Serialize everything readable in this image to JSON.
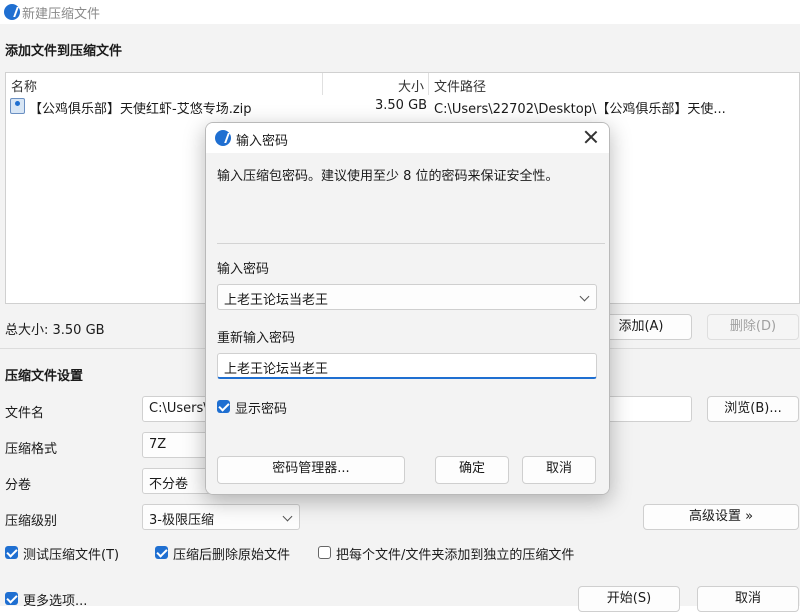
{
  "window": {
    "title": "新建压缩文件"
  },
  "add_section": {
    "title": "添加文件到压缩文件"
  },
  "file_list": {
    "columns": [
      "名称",
      "大小",
      "文件路径"
    ],
    "rows": [
      {
        "name": "【公鸡俱乐部】天使红虾-艾悠专场.zip",
        "size": "3.50 GB",
        "path": "C:\\Users\\22702\\Desktop\\【公鸡俱乐部】天使..."
      }
    ]
  },
  "total": {
    "label": "总大小: 3.50 GB"
  },
  "buttons": {
    "add": "添加(A)",
    "delete": "删除(D)",
    "browse": "浏览(B)...",
    "advanced": "高级设置 »",
    "start": "开始(S)",
    "cancel": "取消"
  },
  "settings": {
    "title": "压缩文件设置",
    "filename_label": "文件名",
    "filename_value": "C:\\Users\\",
    "format_label": "压缩格式",
    "format_value": "7Z",
    "volume_label": "分卷",
    "volume_value": "不分卷",
    "level_label": "压缩级别",
    "level_value": "3-极限压缩"
  },
  "options": {
    "test": {
      "label": "测试压缩文件(T)",
      "checked": true
    },
    "delete_after": {
      "label": "压缩后删除原始文件",
      "checked": true
    },
    "separate": {
      "label": "把每个文件/文件夹添加到独立的压缩文件",
      "checked": false
    },
    "more": {
      "label": "更多选项...",
      "checked": true
    }
  },
  "dialog": {
    "title": "输入密码",
    "description": "输入压缩包密码。建议使用至少 8 位的密码来保证安全性。",
    "password_label": "输入密码",
    "password_value": "上老王论坛当老王",
    "confirm_label": "重新输入密码",
    "confirm_value": "上老王论坛当老王",
    "show_password": {
      "label": "显示密码",
      "checked": true
    },
    "manager_button": "密码管理器...",
    "ok_button": "确定",
    "cancel_button": "取消"
  },
  "colors": {
    "accent": "#1f6fd1"
  }
}
